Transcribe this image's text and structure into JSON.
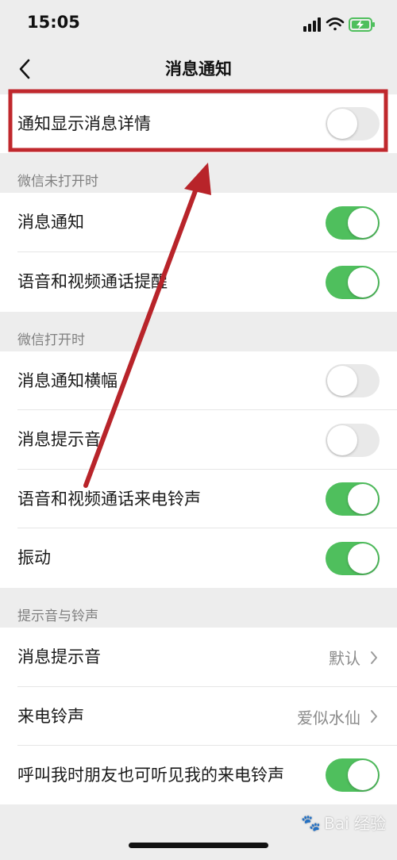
{
  "status_bar": {
    "time": "15:05"
  },
  "nav": {
    "title": "消息通知"
  },
  "top_row": {
    "label": "通知显示消息详情",
    "toggle_on": false
  },
  "sections": [
    {
      "header": "微信未打开时",
      "items": [
        {
          "label": "消息通知",
          "toggle_on": true
        },
        {
          "label": "语音和视频通话提醒",
          "toggle_on": true
        }
      ]
    },
    {
      "header": "微信打开时",
      "items": [
        {
          "label": "消息通知横幅",
          "toggle_on": false
        },
        {
          "label": "消息提示音",
          "toggle_on": false
        },
        {
          "label": "语音和视频通话来电铃声",
          "toggle_on": true
        },
        {
          "label": "振动",
          "toggle_on": true
        }
      ]
    },
    {
      "header": "提示音与铃声",
      "items": [
        {
          "label": "消息提示音",
          "value": "默认"
        },
        {
          "label": "来电铃声",
          "value": "爱似水仙"
        },
        {
          "label": "呼叫我时朋友也可听见我的来电铃声",
          "toggle_on": true
        }
      ]
    }
  ],
  "watermark": {
    "text": "Bai 经验"
  },
  "colors": {
    "toggle_on": "#4fbf5d",
    "toggle_off": "#e9e9e9",
    "highlight": "#c0282d",
    "background": "#ededed"
  }
}
